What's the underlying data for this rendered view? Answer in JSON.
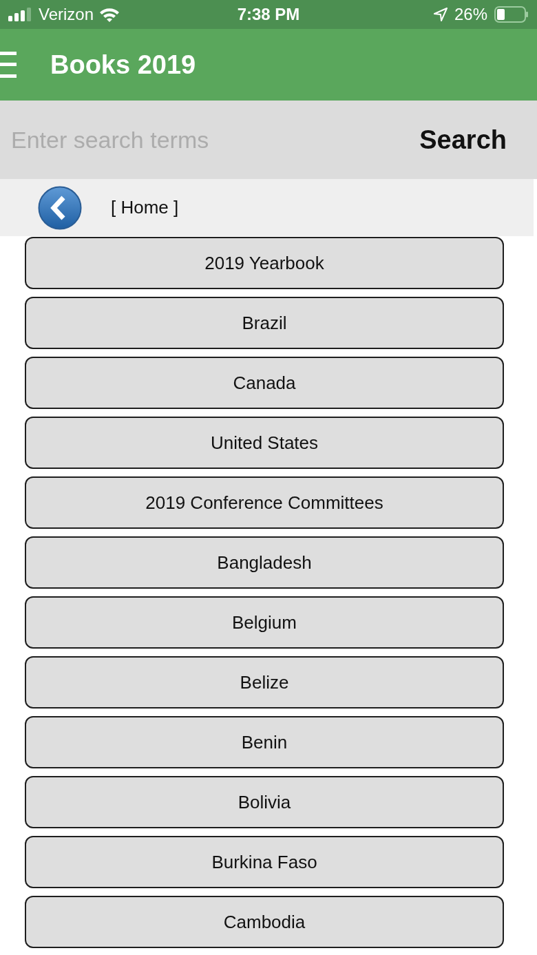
{
  "status_bar": {
    "carrier": "Verizon",
    "time": "7:38 PM",
    "battery": "26%"
  },
  "app_bar": {
    "title": "Books 2019"
  },
  "search": {
    "placeholder": "Enter search terms",
    "button": "Search"
  },
  "breadcrumb": {
    "label": "[ Home ]"
  },
  "items": [
    "2019 Yearbook",
    "Brazil",
    "Canada",
    "United States",
    "2019 Conference Committees",
    "Bangladesh",
    "Belgium",
    "Belize",
    "Benin",
    "Bolivia",
    "Burkina Faso",
    "Cambodia"
  ]
}
